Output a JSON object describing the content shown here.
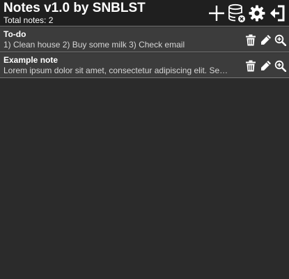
{
  "header": {
    "title": "Notes v1.0 by SNBLST",
    "total_label": "Total notes: 2"
  },
  "toolbar": {
    "icons": [
      "plus-icon",
      "database-delete-icon",
      "gear-icon",
      "exit-icon"
    ]
  },
  "notes": [
    {
      "title": "To-do",
      "preview": "1) Clean house 2) Buy some milk 3) Check email"
    },
    {
      "title": "Example note",
      "preview": "Lorem ipsum dolor sit amet, consectetur adipiscing elit. Sed do eiusmod tempor"
    }
  ],
  "note_actions": [
    "trash-icon",
    "pencil-icon",
    "zoom-in-icon"
  ],
  "colors": {
    "background": "#2b2b2b",
    "header": "#1f1f1f",
    "note_row": "#3c3c3c",
    "divider": "#777777",
    "text": "#ffffff"
  }
}
